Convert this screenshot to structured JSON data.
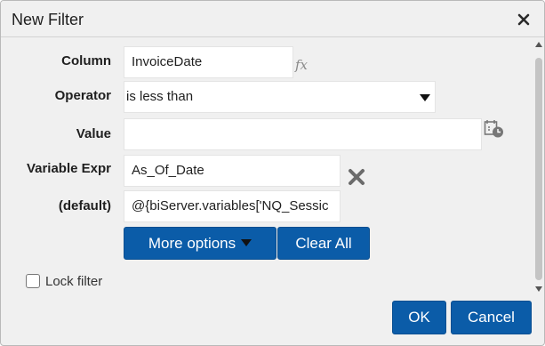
{
  "dialog": {
    "title": "New Filter"
  },
  "form": {
    "column": {
      "label": "Column",
      "value": "InvoiceDate"
    },
    "operator": {
      "label": "Operator",
      "value": "is less than"
    },
    "value": {
      "label": "Value",
      "value": ""
    },
    "variable_expr": {
      "label": "Variable Expr",
      "value": "As_Of_Date"
    },
    "default": {
      "label": "(default)",
      "value": "@{biServer.variables['NQ_Sessic"
    }
  },
  "buttons": {
    "more_options": "More options",
    "clear_all": "Clear All",
    "ok": "OK",
    "cancel": "Cancel"
  },
  "lock_filter": {
    "label": "Lock filter",
    "checked": false
  },
  "icons": {
    "close": "close-icon",
    "fx": "fx-icon",
    "calendar": "calendar-icon",
    "remove": "remove-x-icon",
    "dropdown": "chevron-down-icon"
  },
  "colors": {
    "primary_button": "#0b5ca8",
    "dialog_bg": "#f0f0f0"
  }
}
